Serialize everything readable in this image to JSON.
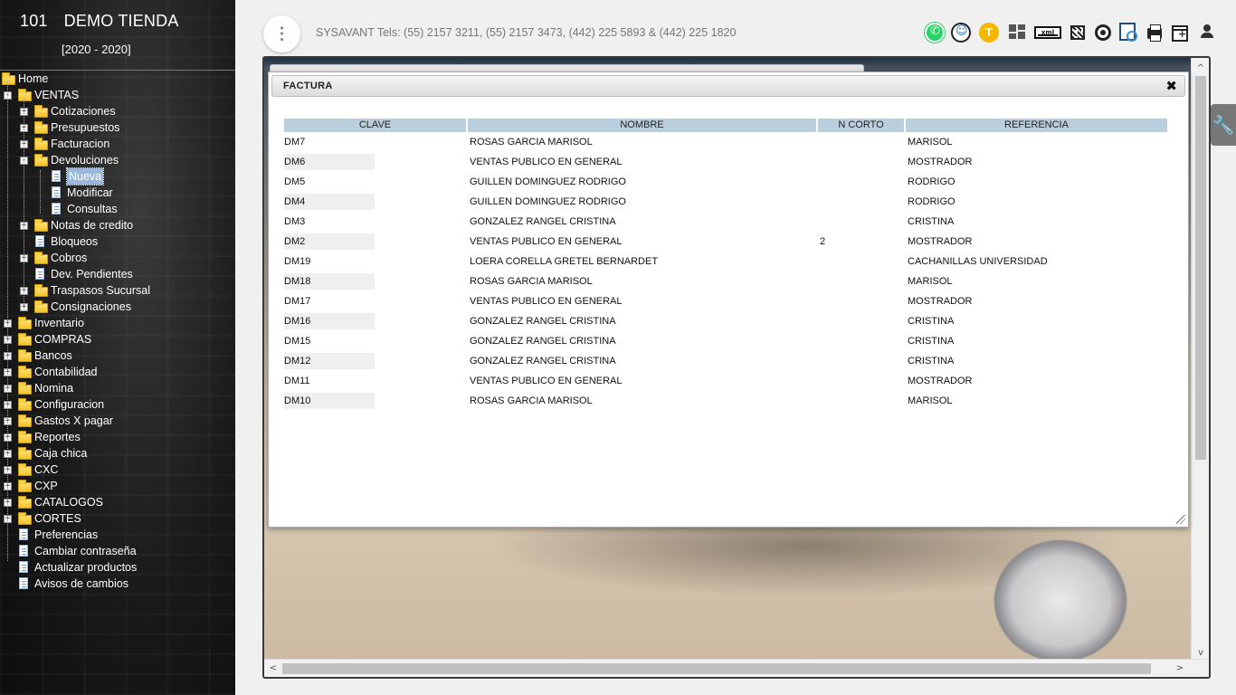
{
  "sidebar": {
    "company_number": "101",
    "company_name": "DEMO TIENDA",
    "period": "[2020 - 2020]",
    "tree": [
      {
        "label": "Home",
        "depth": 0,
        "type": "folder"
      },
      {
        "label": "VENTAS",
        "depth": 1,
        "type": "folder",
        "expanded": true
      },
      {
        "label": "Cotizaciones",
        "depth": 2,
        "type": "folder"
      },
      {
        "label": "Presupuestos",
        "depth": 2,
        "type": "folder"
      },
      {
        "label": "Facturacion",
        "depth": 2,
        "type": "folder"
      },
      {
        "label": "Devoluciones",
        "depth": 2,
        "type": "folder",
        "expanded": true
      },
      {
        "label": "Nueva",
        "depth": 3,
        "type": "doc",
        "selected": true
      },
      {
        "label": "Modificar",
        "depth": 3,
        "type": "doc"
      },
      {
        "label": "Consultas",
        "depth": 3,
        "type": "doc"
      },
      {
        "label": "Notas de credito",
        "depth": 2,
        "type": "folder"
      },
      {
        "label": "Bloqueos",
        "depth": 2,
        "type": "doc"
      },
      {
        "label": "Cobros",
        "depth": 2,
        "type": "folder"
      },
      {
        "label": "Dev. Pendientes",
        "depth": 2,
        "type": "doc"
      },
      {
        "label": "Traspasos Sucursal",
        "depth": 2,
        "type": "folder"
      },
      {
        "label": "Consignaciones",
        "depth": 2,
        "type": "folder"
      },
      {
        "label": "Inventario",
        "depth": 1,
        "type": "folder"
      },
      {
        "label": "COMPRAS",
        "depth": 1,
        "type": "folder"
      },
      {
        "label": "Bancos",
        "depth": 1,
        "type": "folder"
      },
      {
        "label": "Contabilidad",
        "depth": 1,
        "type": "folder"
      },
      {
        "label": "Nomina",
        "depth": 1,
        "type": "folder"
      },
      {
        "label": "Configuracion",
        "depth": 1,
        "type": "folder"
      },
      {
        "label": "Gastos X pagar",
        "depth": 1,
        "type": "folder"
      },
      {
        "label": "Reportes",
        "depth": 1,
        "type": "folder"
      },
      {
        "label": "Caja chica",
        "depth": 1,
        "type": "folder"
      },
      {
        "label": "CXC",
        "depth": 1,
        "type": "folder"
      },
      {
        "label": "CXP",
        "depth": 1,
        "type": "folder"
      },
      {
        "label": "CATALOGOS",
        "depth": 1,
        "type": "folder"
      },
      {
        "label": "CORTES",
        "depth": 1,
        "type": "folder"
      },
      {
        "label": "Preferencias",
        "depth": 1,
        "type": "doc"
      },
      {
        "label": "Cambiar contraseña",
        "depth": 1,
        "type": "doc"
      },
      {
        "label": "Actualizar productos",
        "depth": 1,
        "type": "doc"
      },
      {
        "label": "Avisos de cambios",
        "depth": 1,
        "type": "doc"
      }
    ]
  },
  "header": {
    "menu_icon": "⋮",
    "contact": "SYSAVANT Tels: (55) 2157 3211, (55) 2157 3473, (442) 225 5893 & (442) 225 1820",
    "toolbar_icons": [
      "whatsapp-icon",
      "support-icon",
      "t-coin-icon",
      "dashboard-grid-icon",
      "xml-icon",
      "qr-code-icon",
      "target-icon",
      "report-search-icon",
      "printer-icon",
      "new-window-icon",
      "user-icon"
    ],
    "t_coin_label": "T",
    "xml_label": "xml"
  },
  "dialog": {
    "title": "FACTURA",
    "close_icon": "✖",
    "columns": [
      "CLAVE",
      "NOMBRE",
      "N CORTO",
      "REFERENCIA"
    ],
    "rows": [
      {
        "clave": "DM7",
        "nombre": "ROSAS GARCIA MARISOL",
        "ncorto": "",
        "referencia": "MARISOL"
      },
      {
        "clave": "DM6",
        "nombre": "VENTAS PUBLICO EN GENERAL",
        "ncorto": "",
        "referencia": "MOSTRADOR"
      },
      {
        "clave": "DM5",
        "nombre": "GUILLEN DOMINGUEZ RODRIGO",
        "ncorto": "",
        "referencia": "RODRIGO"
      },
      {
        "clave": "DM4",
        "nombre": "GUILLEN DOMINGUEZ RODRIGO",
        "ncorto": "",
        "referencia": "RODRIGO"
      },
      {
        "clave": "DM3",
        "nombre": "GONZALEZ RANGEL CRISTINA",
        "ncorto": "",
        "referencia": "CRISTINA"
      },
      {
        "clave": "DM2",
        "nombre": "VENTAS PUBLICO EN GENERAL",
        "ncorto": "2",
        "referencia": "MOSTRADOR"
      },
      {
        "clave": "DM19",
        "nombre": "LOERA CORELLA GRETEL BERNARDET",
        "ncorto": "",
        "referencia": "CACHANILLAS UNIVERSIDAD"
      },
      {
        "clave": "DM18",
        "nombre": "ROSAS GARCIA MARISOL",
        "ncorto": "",
        "referencia": "MARISOL"
      },
      {
        "clave": "DM17",
        "nombre": "VENTAS PUBLICO EN GENERAL",
        "ncorto": "",
        "referencia": "MOSTRADOR"
      },
      {
        "clave": "DM16",
        "nombre": "GONZALEZ RANGEL CRISTINA",
        "ncorto": "",
        "referencia": "CRISTINA"
      },
      {
        "clave": "DM15",
        "nombre": "GONZALEZ RANGEL CRISTINA",
        "ncorto": "",
        "referencia": "CRISTINA"
      },
      {
        "clave": "DM12",
        "nombre": "GONZALEZ RANGEL CRISTINA",
        "ncorto": "",
        "referencia": "CRISTINA"
      },
      {
        "clave": "DM11",
        "nombre": "VENTAS PUBLICO EN GENERAL",
        "ncorto": "",
        "referencia": "MOSTRADOR"
      },
      {
        "clave": "DM10",
        "nombre": "ROSAS GARCIA MARISOL",
        "ncorto": "",
        "referencia": "MARISOL"
      }
    ]
  },
  "side_tool": {
    "icon": "wrench-icon",
    "glyph": "🔧"
  },
  "colors": {
    "table_header": "#b9cfdd",
    "sidebar_bg": "#1a1a1a",
    "selected_node": "#9ab8dc"
  }
}
